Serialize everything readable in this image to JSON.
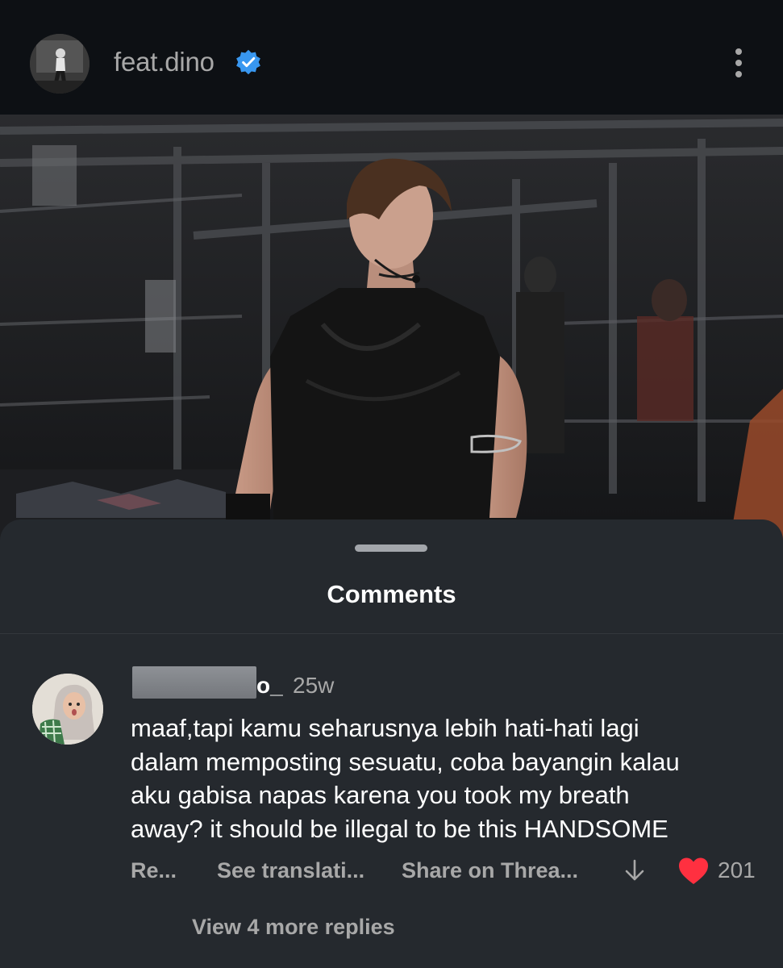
{
  "header": {
    "username": "feat.dino",
    "verified_icon": "verified-badge-icon",
    "more_icon": "more-vertical-icon"
  },
  "post": {
    "image": "post-photo"
  },
  "comments_sheet": {
    "title": "Comments",
    "comment": {
      "username_visible_suffix": "o_",
      "time": "25w",
      "text": "maaf,tapi kamu seharusnya lebih hati-hati lagi\ndalam memposting sesuatu, coba bayangin kalau\naku gabisa napas karena you took my breath\naway? it should be illegal to be this HANDSOME",
      "actions": {
        "reply": "Re...",
        "translate": "See translati...",
        "share": "Share on Threa..."
      },
      "down_icon": "arrow-down-icon",
      "heart_icon": "heart-filled-icon",
      "like_count": "201",
      "view_replies": "View 4 more replies"
    }
  },
  "colors": {
    "background": "#0d1014",
    "sheet": "#25292e",
    "text_primary": "#ffffff",
    "text_secondary": "#a8a8a8",
    "verified_blue": "#3897f0",
    "heart_red": "#ff3040"
  }
}
